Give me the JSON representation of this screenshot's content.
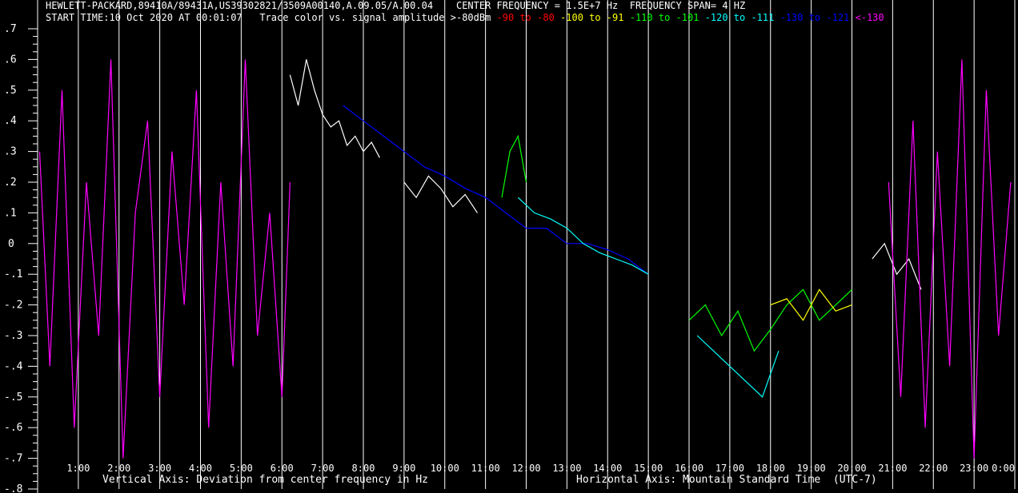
{
  "header": {
    "instrument": "HEWLETT-PACKARD,89410A/89431A,US39302821/3509A00140,A.09.05/A.00.04",
    "center_frequency": "CENTER FREQUENCY = 1.5E+7 Hz",
    "frequency_span": "FREQUENCY SPAN= 4 HZ",
    "start_time": "START TIME:10 Oct 2020 AT 00:01:07",
    "legend_title": "Trace color vs. signal amplitude",
    "legend": [
      {
        "label": ">-80dBm",
        "color": "#ffffff"
      },
      {
        "label": "-90 to -80",
        "color": "#ff0000"
      },
      {
        "label": "-100 to -91",
        "color": "#ffff00"
      },
      {
        "label": "-110 to -101",
        "color": "#00ff00"
      },
      {
        "label": "-120 to -111",
        "color": "#00ffff"
      },
      {
        "label": "-130 to -121",
        "color": "#0000ff"
      },
      {
        "label": "<-130",
        "color": "#ff00ff"
      }
    ]
  },
  "footer": {
    "vertical_axis": "Vertical Axis: Deviation from center frequency in Hz",
    "horizontal_axis": "Horizontal Axis: Mountain Standard Time  (UTC-7)"
  },
  "chart_data": {
    "type": "line",
    "x_unit": "hour (MST)",
    "xlim": [
      0,
      24
    ],
    "ylim": [
      -0.8,
      0.7
    ],
    "y_ticks": [
      ".7",
      ".6",
      ".5",
      ".4",
      ".3",
      ".2",
      ".1",
      "0",
      "-.1",
      "-.2",
      "-.3",
      "-.4",
      "-.5",
      "-.6",
      "-.7",
      "-.8"
    ],
    "x_ticks": [
      "1:00",
      "2:00",
      "3:00",
      "4:00",
      "5:00",
      "6:00",
      "7:00",
      "8:00",
      "9:00",
      "10:00",
      "11:00",
      "12:00",
      "13:00",
      "14:00",
      "15:00",
      "16:00",
      "17:00",
      "18:00",
      "19:00",
      "20:00",
      "21:00",
      "22:00",
      "23:00",
      "0:00"
    ],
    "grid": true,
    "series": [
      {
        "color": "#ff00ff",
        "x": [
          0.05,
          0.3,
          0.6,
          0.9,
          1.2,
          1.5,
          1.8,
          2.1,
          2.4,
          2.7,
          3.0,
          3.3,
          3.6,
          3.9,
          4.2,
          4.5,
          4.8,
          5.1,
          5.4,
          5.7,
          6.0,
          6.2
        ],
        "y": [
          0.3,
          -0.4,
          0.5,
          -0.6,
          0.2,
          -0.3,
          0.6,
          -0.7,
          0.1,
          0.4,
          -0.5,
          0.3,
          -0.2,
          0.5,
          -0.6,
          0.2,
          -0.4,
          0.6,
          -0.3,
          0.1,
          -0.5,
          0.2
        ]
      },
      {
        "color": "#ffffff",
        "x": [
          6.2,
          6.4,
          6.6,
          6.8,
          7.0,
          7.2,
          7.4,
          7.6,
          7.8,
          8.0,
          8.2,
          8.4
        ],
        "y": [
          0.55,
          0.45,
          0.6,
          0.5,
          0.42,
          0.38,
          0.4,
          0.32,
          0.35,
          0.3,
          0.33,
          0.28
        ]
      },
      {
        "color": "#0000ff",
        "x": [
          7.5,
          8.0,
          8.5,
          9.0,
          9.5,
          10.0,
          10.5,
          11.0,
          11.5,
          12.0,
          12.5,
          13.0,
          13.5,
          14.0,
          14.5,
          15.0
        ],
        "y": [
          0.45,
          0.4,
          0.35,
          0.3,
          0.25,
          0.22,
          0.18,
          0.15,
          0.1,
          0.05,
          0.05,
          0.0,
          0.0,
          -0.02,
          -0.05,
          -0.1
        ]
      },
      {
        "color": "#ffffff",
        "x": [
          9.0,
          9.3,
          9.6,
          9.9,
          10.2,
          10.5,
          10.8
        ],
        "y": [
          0.2,
          0.15,
          0.22,
          0.18,
          0.12,
          0.16,
          0.1
        ]
      },
      {
        "color": "#00ff00",
        "x": [
          11.4,
          11.6,
          11.8,
          12.0
        ],
        "y": [
          0.15,
          0.3,
          0.35,
          0.2
        ]
      },
      {
        "color": "#00ffff",
        "x": [
          11.8,
          12.2,
          12.6,
          13.0,
          13.4,
          13.8,
          14.2,
          14.6,
          15.0
        ],
        "y": [
          0.15,
          0.1,
          0.08,
          0.05,
          0.0,
          -0.03,
          -0.05,
          -0.07,
          -0.1
        ]
      },
      {
        "color": "#00ff00",
        "x": [
          16.0,
          16.4,
          16.8,
          17.2,
          17.6,
          18.0,
          18.4,
          18.8,
          19.2,
          19.6,
          20.0
        ],
        "y": [
          -0.25,
          -0.2,
          -0.3,
          -0.22,
          -0.35,
          -0.28,
          -0.2,
          -0.15,
          -0.25,
          -0.2,
          -0.15
        ]
      },
      {
        "color": "#00ffff",
        "x": [
          16.2,
          16.6,
          17.0,
          17.4,
          17.8,
          18.2
        ],
        "y": [
          -0.3,
          -0.35,
          -0.4,
          -0.45,
          -0.5,
          -0.35
        ]
      },
      {
        "color": "#ffff00",
        "x": [
          18.0,
          18.4,
          18.8,
          19.2,
          19.6,
          20.0
        ],
        "y": [
          -0.2,
          -0.18,
          -0.25,
          -0.15,
          -0.22,
          -0.2
        ]
      },
      {
        "color": "#ffffff",
        "x": [
          20.5,
          20.8,
          21.1,
          21.4,
          21.7
        ],
        "y": [
          -0.05,
          0.0,
          -0.1,
          -0.05,
          -0.15
        ]
      },
      {
        "color": "#ff00ff",
        "x": [
          20.9,
          21.2,
          21.5,
          21.8,
          22.1,
          22.4,
          22.7,
          23.0,
          23.3,
          23.6,
          23.9
        ],
        "y": [
          0.2,
          -0.5,
          0.4,
          -0.6,
          0.3,
          -0.4,
          0.6,
          -0.7,
          0.5,
          -0.3,
          0.2
        ]
      }
    ]
  }
}
